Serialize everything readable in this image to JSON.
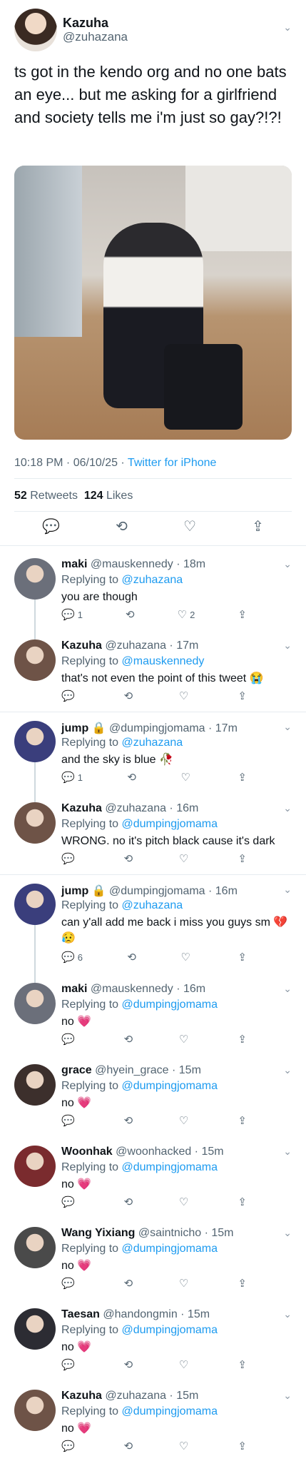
{
  "main": {
    "name": "Kazuha",
    "handle": "@zuhazana",
    "text": "ts got in the kendo org and no one bats an eye... but me asking for a girlfriend and society tells me i'm just so gay?!?!",
    "time": "10:18 PM · 06/10/25 · ",
    "source": "Twitter for iPhone",
    "retweets": "52",
    "retweets_label": " Retweets",
    "likes": "124",
    "likes_label": " Likes"
  },
  "replies": [
    {
      "name": "maki",
      "meta": " @mauskennedy · 18m",
      "to": "@zuhazana",
      "text": "you are though",
      "reply_count": "1",
      "like_count": "2",
      "color": "#6b6f7a"
    },
    {
      "name": "Kazuha",
      "meta": " @zuhazana · 17m",
      "to": "@mauskennedy",
      "text": "that's not even the point of this tweet 😭",
      "reply_count": "",
      "like_count": "",
      "color": "#6e5347"
    },
    {
      "name": "jump 🔒",
      "meta": " @dumpingjomama · 17m",
      "to": "@zuhazana",
      "text": "and the sky is blue 🥀",
      "reply_count": "1",
      "like_count": "",
      "color": "#3a3e7c"
    },
    {
      "name": "Kazuha",
      "meta": " @zuhazana · 16m",
      "to": "@dumpingjomama",
      "text": "WRONG. no it's pitch black cause it's dark",
      "reply_count": "",
      "like_count": "",
      "color": "#6e5347"
    },
    {
      "name": "jump 🔒",
      "meta": " @dumpingjomama · 16m",
      "to": "@zuhazana",
      "text": "can y'all add me back i miss you guys sm 💔😥",
      "reply_count": "6",
      "like_count": "",
      "color": "#3a3e7c"
    },
    {
      "name": "maki",
      "meta": " @mauskennedy · 16m",
      "to": "@dumpingjomama",
      "text": "no 💗",
      "reply_count": "",
      "like_count": "",
      "color": "#6b6f7a"
    },
    {
      "name": "grace",
      "meta": " @hyein_grace · 15m",
      "to": "@dumpingjomama",
      "text": "no 💗",
      "reply_count": "",
      "like_count": "",
      "color": "#3c2f2c"
    },
    {
      "name": "Woonhak",
      "meta": " @woonhacked · 15m",
      "to": "@dumpingjomama",
      "text": "no 💗",
      "reply_count": "",
      "like_count": "",
      "color": "#7a2b2e"
    },
    {
      "name": "Wang Yixiang",
      "meta": " @saintnicho · 15m",
      "to": "@dumpingjomama",
      "text": "no 💗",
      "reply_count": "",
      "like_count": "",
      "color": "#4a4a4a"
    },
    {
      "name": "Taesan",
      "meta": " @handongmin · 15m",
      "to": "@dumpingjomama",
      "text": "no 💗",
      "reply_count": "",
      "like_count": "",
      "color": "#2c2c33"
    },
    {
      "name": "Kazuha",
      "meta": " @zuhazana · 15m",
      "to": "@dumpingjomama",
      "text": "no 💗",
      "reply_count": "",
      "like_count": "",
      "color": "#6e5347"
    }
  ],
  "labels": {
    "replying": "Replying to "
  },
  "icons": {
    "chevron": "chevron-down-icon",
    "reply": "reply-icon",
    "retweet": "retweet-icon",
    "like": "heart-icon",
    "share": "share-icon"
  },
  "colors": {
    "accent": "#1d9bf0",
    "muted": "#536471"
  }
}
